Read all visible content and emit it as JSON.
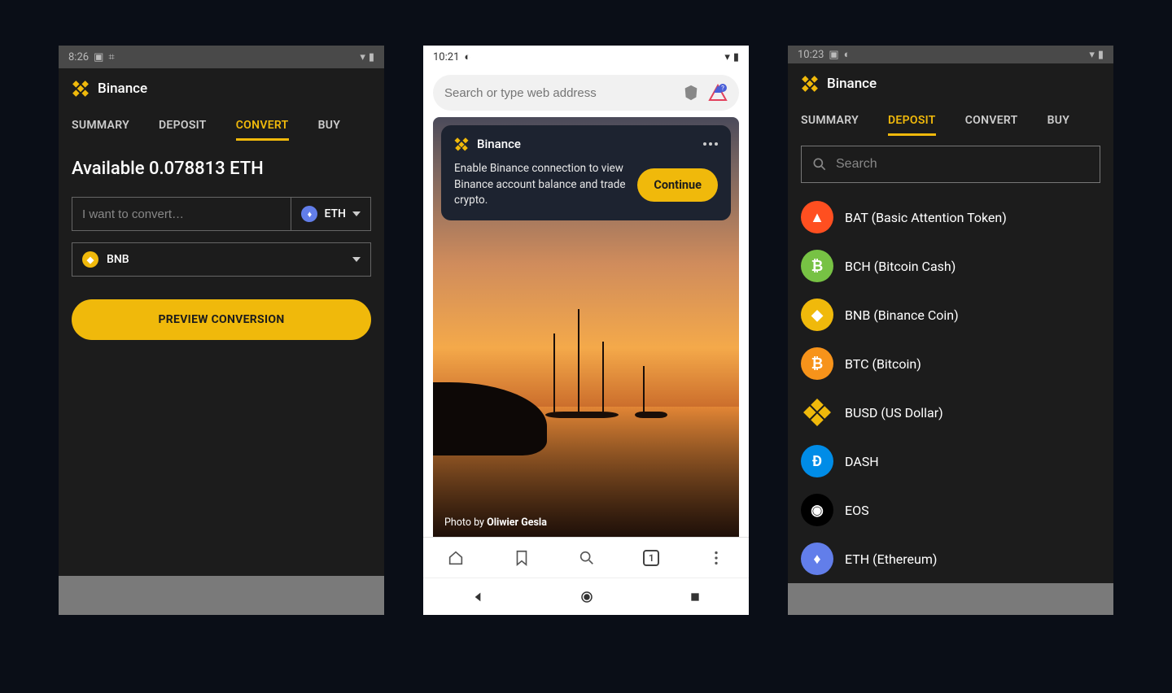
{
  "p1": {
    "time": "8:26",
    "title": "Binance",
    "tabs": [
      "SUMMARY",
      "DEPOSIT",
      "CONVERT",
      "BUY"
    ],
    "active_tab": "CONVERT",
    "available": "Available 0.078813 ETH",
    "input_placeholder": "I want to convert…",
    "from_currency": "ETH",
    "to_currency": "BNB",
    "preview_label": "PREVIEW CONVERSION"
  },
  "p2": {
    "time": "10:21",
    "search_placeholder": "Search or type web address",
    "widget_title": "Binance",
    "widget_text": "Enable Binance connection to view Binance account balance and trade crypto.",
    "continue_label": "Continue",
    "photo_by": "Photo by ",
    "photographer": "Oliwier Gesla",
    "tab_count": "1"
  },
  "p3": {
    "time": "10:23",
    "title": "Binance",
    "tabs": [
      "SUMMARY",
      "DEPOSIT",
      "CONVERT",
      "BUY"
    ],
    "active_tab": "DEPOSIT",
    "search_placeholder": "Search",
    "coins": [
      {
        "sym": "BAT",
        "label": "BAT (Basic Attention Token)",
        "bg": "#ff4f20"
      },
      {
        "sym": "BCH",
        "label": "BCH (Bitcoin Cash)",
        "bg": "#77c244"
      },
      {
        "sym": "BNB",
        "label": "BNB (Binance Coin)",
        "bg": "#f0b90b"
      },
      {
        "sym": "BTC",
        "label": "BTC (Bitcoin)",
        "bg": "#f7931a"
      },
      {
        "sym": "BUSD",
        "label": "BUSD (US Dollar)",
        "bg": "transparent"
      },
      {
        "sym": "DASH",
        "label": "DASH",
        "bg": "#008ce7"
      },
      {
        "sym": "EOS",
        "label": "EOS",
        "bg": "#000000"
      },
      {
        "sym": "ETH",
        "label": "ETH (Ethereum)",
        "bg": "#627eea"
      }
    ]
  }
}
